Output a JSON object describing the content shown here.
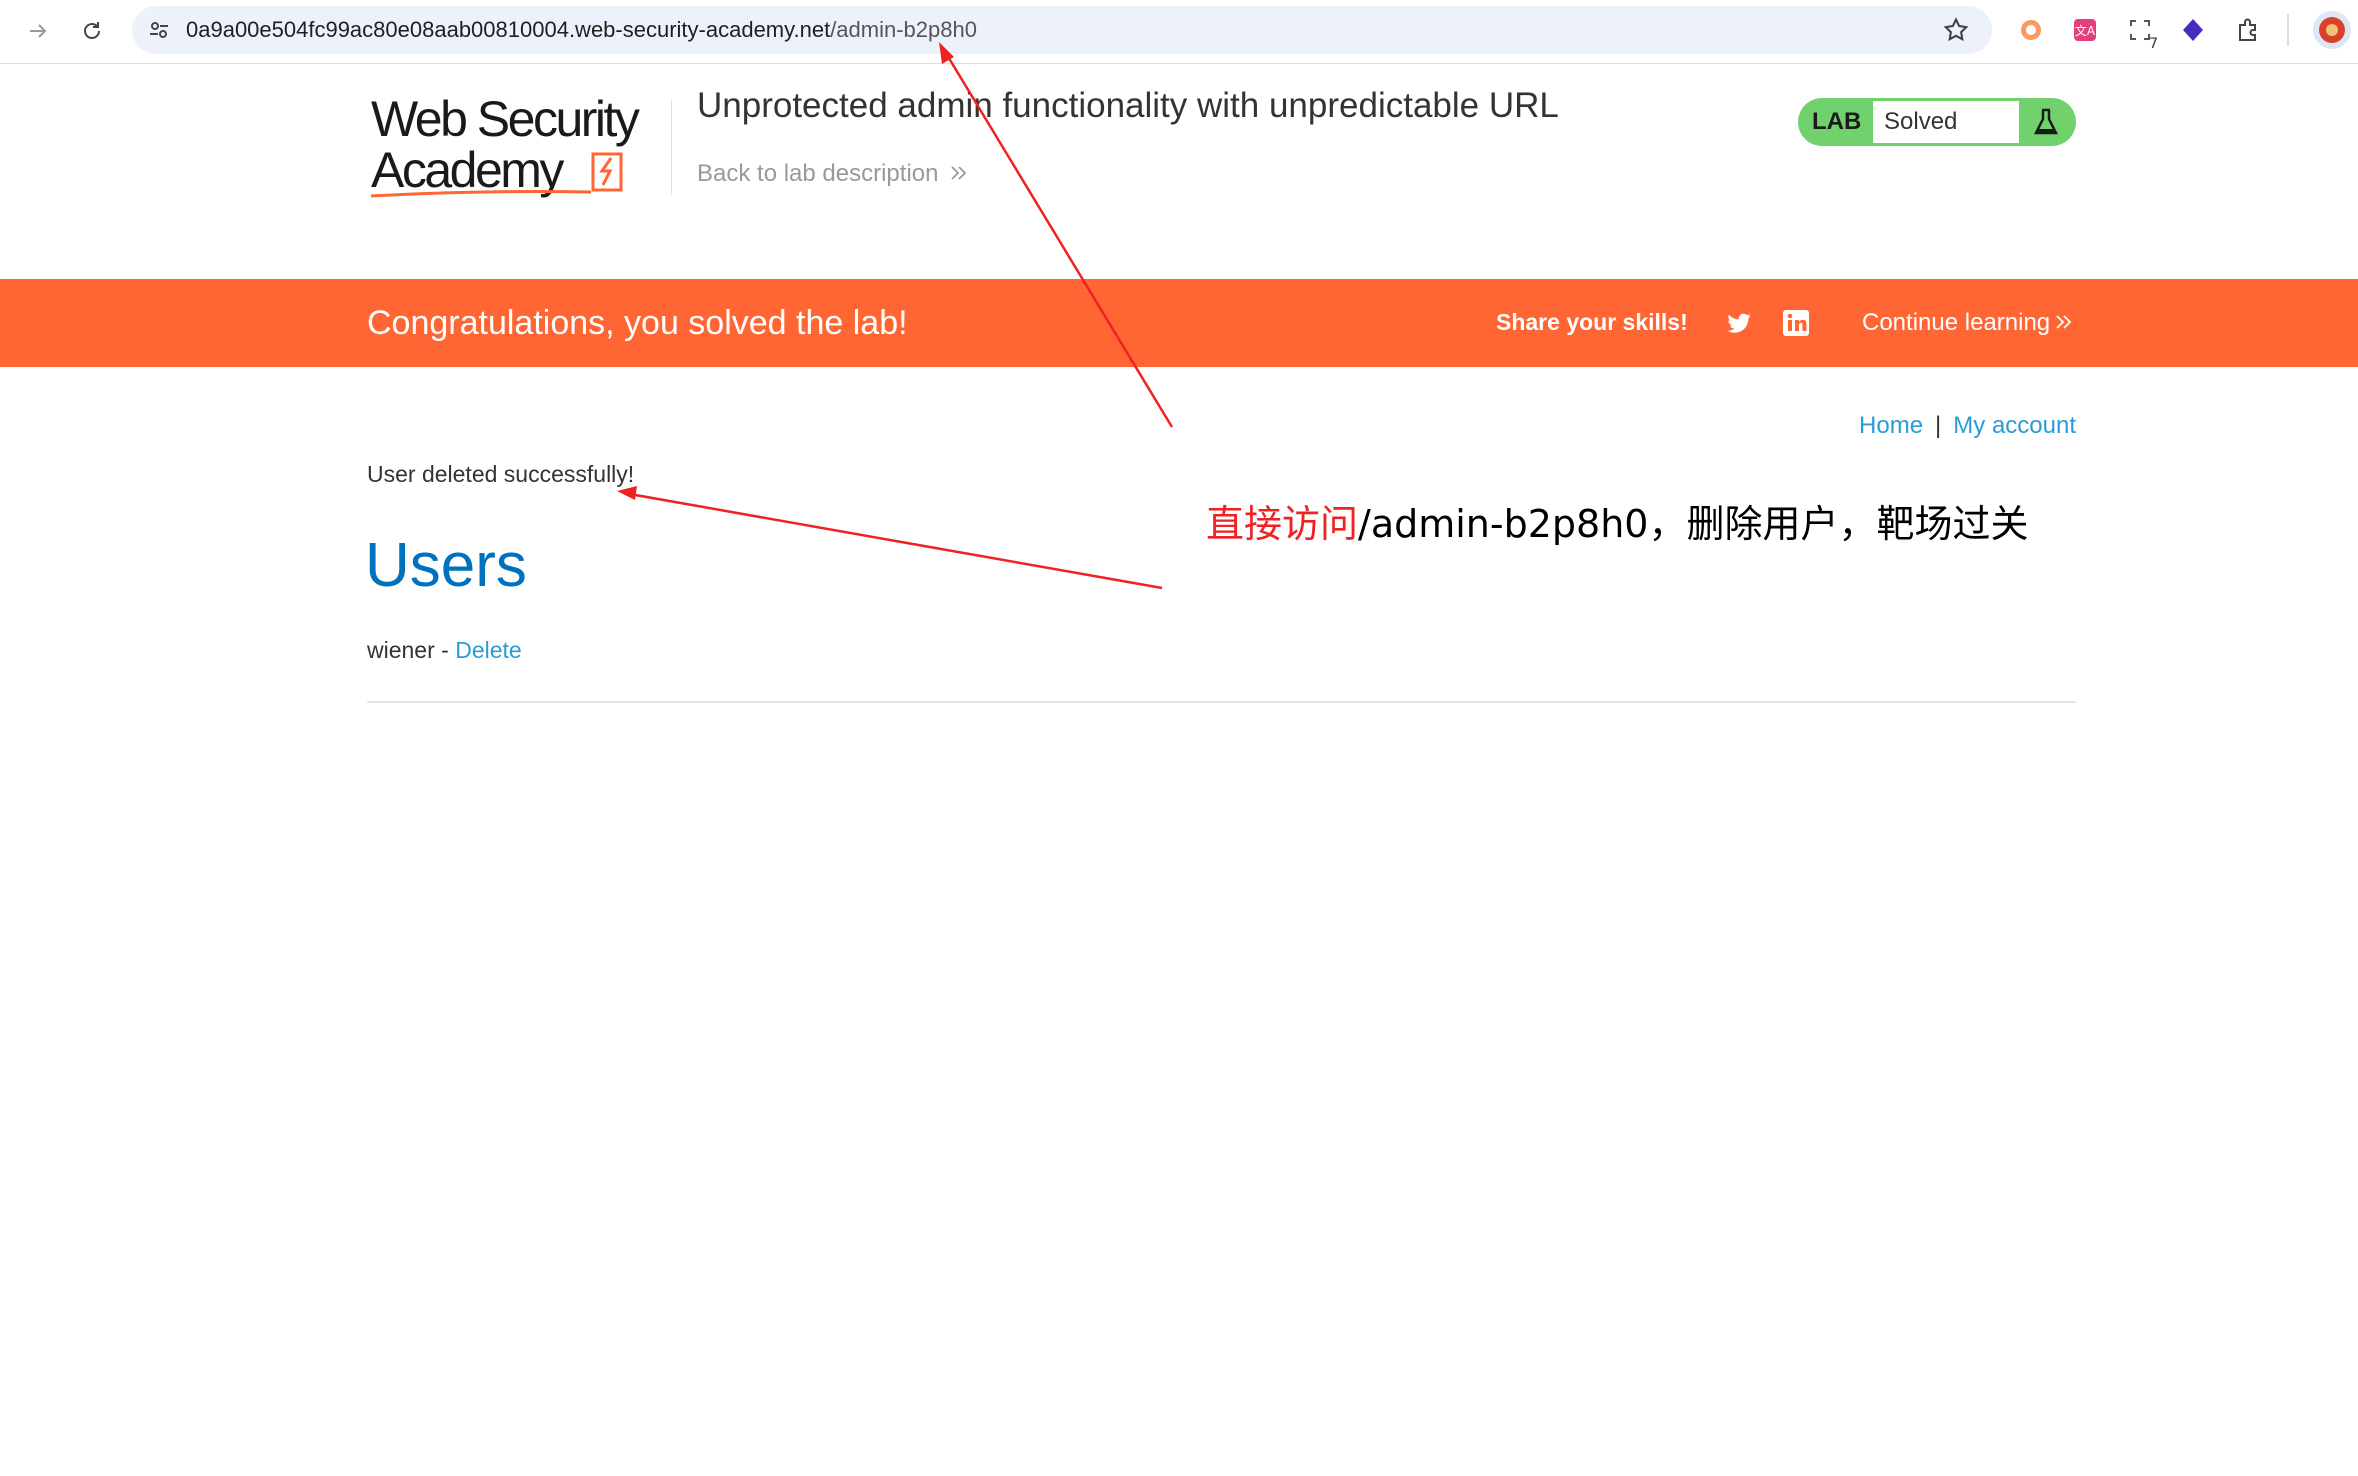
{
  "browser": {
    "url_host": "0a9a00e504fc99ac80e08aab00810004.web-security-academy.net",
    "url_path": "/admin-b2p8h0",
    "extension_badge": "7"
  },
  "header": {
    "logo_text_line1": "Web Security",
    "logo_text_line2": "Academy",
    "lab_title": "Unprotected admin functionality with unpredictable URL",
    "back_link": "Back to lab description",
    "lab_badge_label": "LAB",
    "lab_status": "Solved"
  },
  "banner": {
    "message": "Congratulations, you solved the lab!",
    "share": "Share your skills!",
    "continue": "Continue learning"
  },
  "nav": {
    "home": "Home",
    "separator": "|",
    "my_account": "My account"
  },
  "main": {
    "success_message": "User deleted successfully!",
    "heading": "Users",
    "user_name": "wiener",
    "user_sep": " - ",
    "delete_label": "Delete"
  },
  "annotation": {
    "red_part": "直接访问",
    "black_part": "/admin-b2p8h0，删除用户，靶场过关"
  },
  "colors": {
    "accent_orange": "#ff6633",
    "solved_green": "#70d16d",
    "link_blue": "#2a9bd6",
    "heading_blue": "#0071bc",
    "annotation_red": "#ee2222"
  },
  "icons": [
    "forward-arrow-icon",
    "reload-icon",
    "site-info-icon",
    "star-icon",
    "extension-icons",
    "puzzle-icon",
    "profile-avatar-icon",
    "flask-icon",
    "twitter-icon",
    "linkedin-icon"
  ]
}
